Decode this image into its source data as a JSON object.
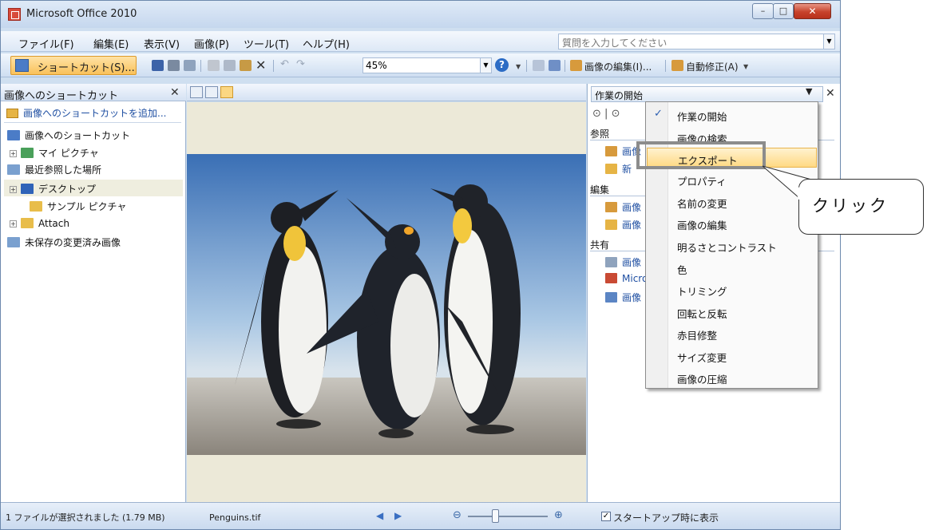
{
  "window": {
    "title": "Microsoft Office 2010",
    "min_glyph": "–",
    "max_glyph": "□",
    "close_glyph": "✕"
  },
  "menubar": {
    "items": [
      "ファイル(F)",
      "編集(E)",
      "表示(V)",
      "画像(P)",
      "ツール(T)",
      "ヘルプ(H)"
    ],
    "help_placeholder": "質問を入力してください"
  },
  "toolbar": {
    "shortcut_label": "ショートカット(S)...",
    "zoom_value": "45%",
    "edit_picture_label": "画像の編集(I)...",
    "auto_correct_label": "自動修正(A)"
  },
  "left_pane": {
    "title": "画像へのショートカット",
    "add_shortcut": "画像へのショートカットを追加...",
    "tree": [
      {
        "label": "画像へのショートカット"
      },
      {
        "label": "マイ ピクチャ"
      },
      {
        "label": "最近参照した場所"
      },
      {
        "label": "デスクトップ"
      },
      {
        "label": "サンプル ピクチャ"
      },
      {
        "label": "Attach"
      },
      {
        "label": "未保存の変更済み画像"
      }
    ]
  },
  "statusbar": {
    "selection": "1 ファイルが選択されました (1.79 MB)",
    "filename": "Penguins.tif",
    "startup_label": "スタートアップ時に表示"
  },
  "task_pane": {
    "title": "作業の開始",
    "sections": {
      "browse": "参照",
      "edit": "編集",
      "share": "共有"
    },
    "links": {
      "browse_1": "画像",
      "browse_2": "新",
      "edit_1": "画像",
      "edit_2": "画像",
      "share_1": "画像",
      "share_2": "Micro",
      "share_3": "画像"
    }
  },
  "dropdown": {
    "items": [
      "作業の開始",
      "画像の検索",
      "エクスポート",
      "プロパティ",
      "名前の変更",
      "画像の編集",
      "明るさとコントラスト",
      "色",
      "トリミング",
      "回転と反転",
      "赤目修整",
      "サイズ変更",
      "画像の圧縮"
    ],
    "checked_index": 0,
    "highlighted_index": 2
  },
  "callout": {
    "text": "クリック"
  }
}
